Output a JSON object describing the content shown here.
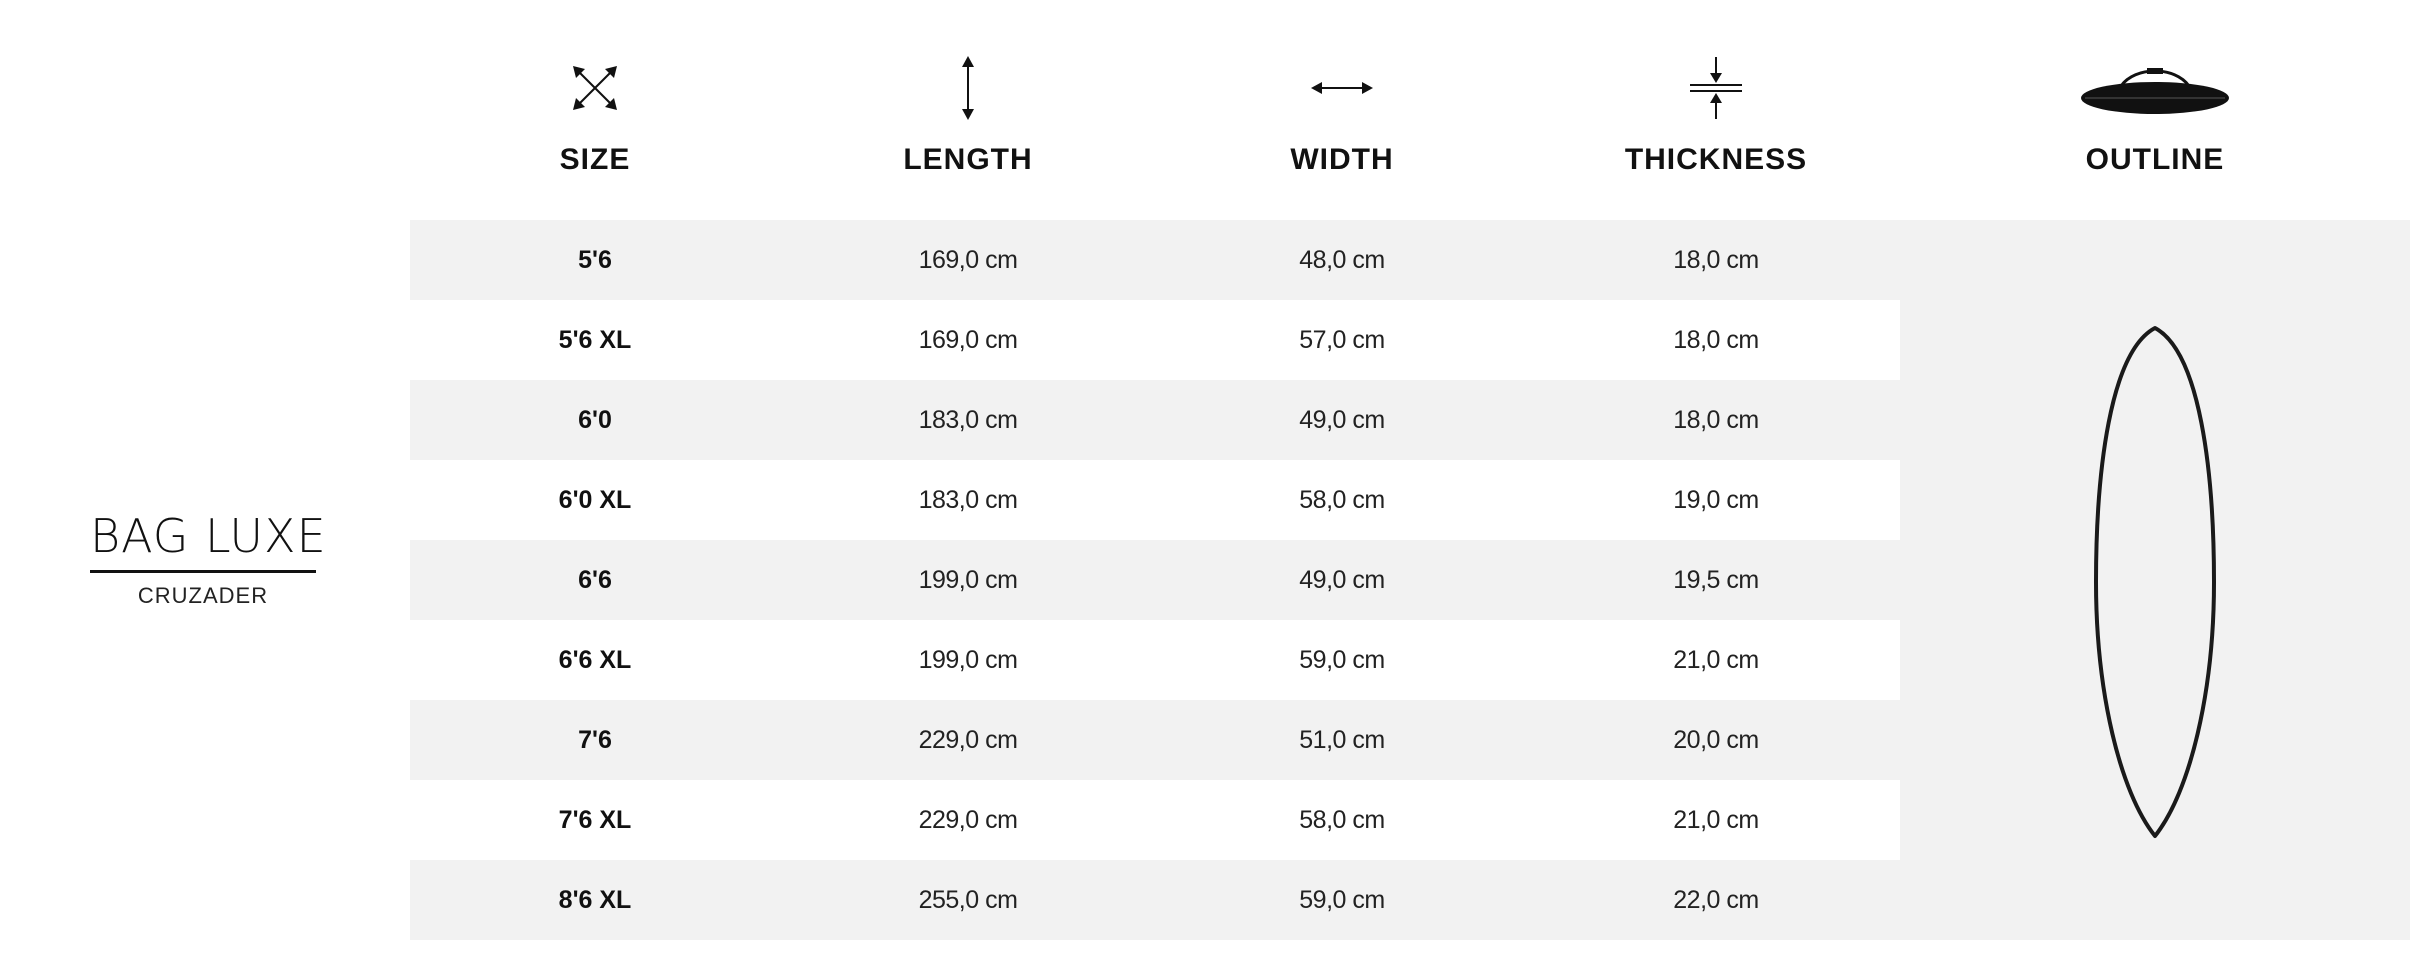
{
  "brand": {
    "title": "BAG LUXE",
    "subtitle": "CRUZADER"
  },
  "headers": {
    "size": "SIZE",
    "length": "LENGTH",
    "width": "WIDTH",
    "thickness": "THICKNESS",
    "outline": "OUTLINE"
  },
  "icons": {
    "size": "diagonal-expand-arrows-icon",
    "length": "vertical-double-arrow-icon",
    "width": "horizontal-double-arrow-icon",
    "thickness": "compress-arrows-icon",
    "outline": "board-bag-icon",
    "board_outline": "surfboard-outline-icon"
  },
  "colors": {
    "text": "#111111",
    "row_shade": "#f2f2f2",
    "row_clear": "#ffffff"
  },
  "rows": [
    {
      "size": "5'6",
      "length": "169,0 cm",
      "width": "48,0 cm",
      "thickness": "18,0 cm"
    },
    {
      "size": "5'6 XL",
      "length": "169,0 cm",
      "width": "57,0 cm",
      "thickness": "18,0 cm"
    },
    {
      "size": "6'0",
      "length": "183,0 cm",
      "width": "49,0 cm",
      "thickness": "18,0 cm"
    },
    {
      "size": "6'0 XL",
      "length": "183,0 cm",
      "width": "58,0 cm",
      "thickness": "19,0 cm"
    },
    {
      "size": "6'6",
      "length": "199,0 cm",
      "width": "49,0 cm",
      "thickness": "19,5 cm"
    },
    {
      "size": "6'6 XL",
      "length": "199,0 cm",
      "width": "59,0 cm",
      "thickness": "21,0 cm"
    },
    {
      "size": "7'6",
      "length": "229,0 cm",
      "width": "51,0 cm",
      "thickness": "20,0 cm"
    },
    {
      "size": "7'6 XL",
      "length": "229,0 cm",
      "width": "58,0 cm",
      "thickness": "21,0 cm"
    },
    {
      "size": "8'6 XL",
      "length": "255,0 cm",
      "width": "59,0 cm",
      "thickness": "22,0 cm"
    }
  ]
}
